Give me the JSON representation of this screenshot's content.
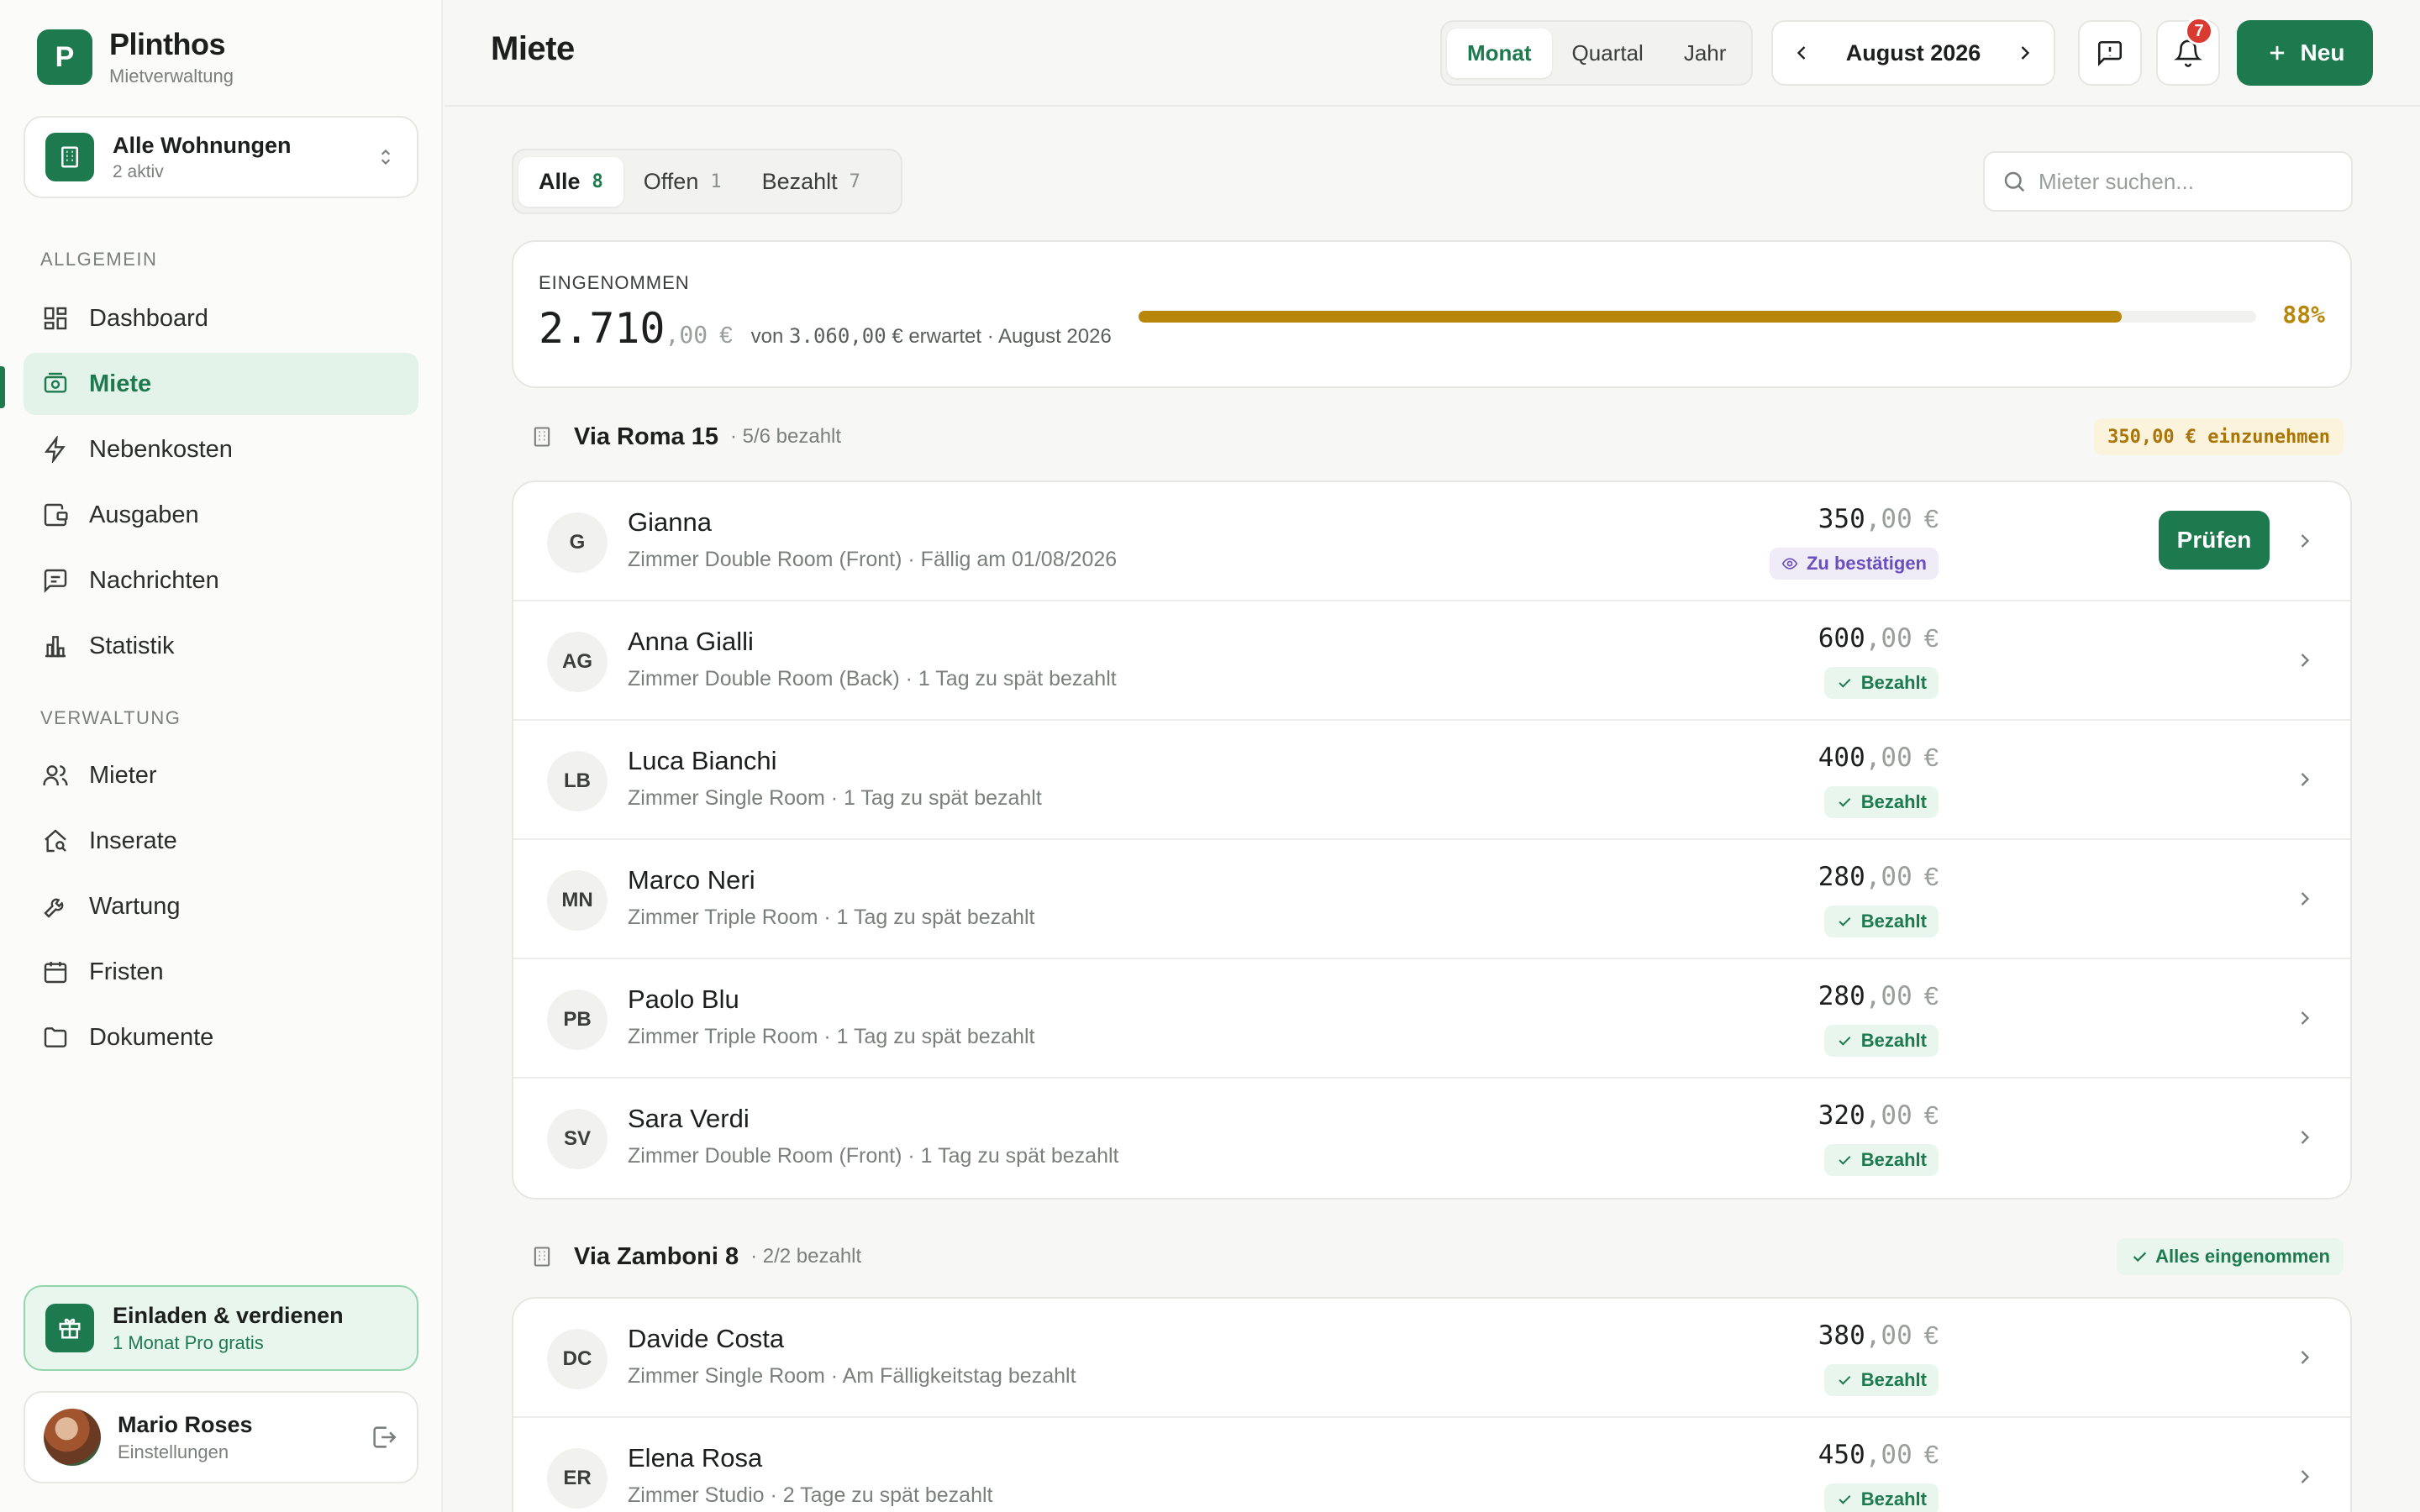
{
  "brand": {
    "logo_letter": "P",
    "name": "Plinthos",
    "subtitle": "Mietverwaltung"
  },
  "property_selector": {
    "title": "Alle Wohnungen",
    "subtitle": "2 aktiv"
  },
  "nav": {
    "section_general": "ALLGEMEIN",
    "section_admin": "VERWALTUNG",
    "items": [
      {
        "label": "Dashboard",
        "icon": "grid-icon"
      },
      {
        "label": "Miete",
        "icon": "rent-icon",
        "active": true
      },
      {
        "label": "Nebenkosten",
        "icon": "bolt-icon"
      },
      {
        "label": "Ausgaben",
        "icon": "wallet-icon"
      },
      {
        "label": "Nachrichten",
        "icon": "message-icon"
      },
      {
        "label": "Statistik",
        "icon": "bar-chart-icon"
      },
      {
        "label": "Mieter",
        "icon": "users-icon"
      },
      {
        "label": "Inserate",
        "icon": "house-search-icon"
      },
      {
        "label": "Wartung",
        "icon": "wrench-icon"
      },
      {
        "label": "Fristen",
        "icon": "calendar-icon"
      },
      {
        "label": "Dokumente",
        "icon": "folder-icon"
      }
    ]
  },
  "invite": {
    "title": "Einladen & verdienen",
    "subtitle": "1 Monat Pro gratis"
  },
  "user": {
    "name": "Mario Roses",
    "subtitle": "Einstellungen"
  },
  "header": {
    "title": "Miete",
    "periods": [
      "Monat",
      "Quartal",
      "Jahr"
    ],
    "active_period": "Monat",
    "date_label": "August 2026",
    "notification_count": "7",
    "new_label": "Neu"
  },
  "filters": [
    {
      "label": "Alle",
      "count": "8",
      "active": true
    },
    {
      "label": "Offen",
      "count": "1"
    },
    {
      "label": "Bezahlt",
      "count": "7"
    }
  ],
  "search": {
    "placeholder": "Mieter suchen..."
  },
  "summary": {
    "label": "EINGENOMMEN",
    "amount_int": "2.710",
    "amount_dec": ",00",
    "currency": "€",
    "von": "von",
    "expected_amount": "3.060,00",
    "expected_suffix": "€ erwartet · August 2026",
    "progress": 0.88,
    "percent_label": "88%"
  },
  "groups": [
    {
      "name": "Via Roma 15",
      "sub": "· 5/6 bezahlt",
      "tag": "350,00 € einzunehmen",
      "tag_type": "amber",
      "rows": [
        {
          "initials": "G",
          "name": "Gianna",
          "sub": "Zimmer Double Room (Front) · Fällig am 01/08/2026",
          "amount_int": "350",
          "amount_dec": ",00",
          "currency": "€",
          "status": "Zu bestätigen",
          "status_type": "confirm",
          "action": "Prüfen"
        },
        {
          "initials": "AG",
          "name": "Anna Gialli",
          "sub": "Zimmer Double Room (Back) · 1 Tag zu spät bezahlt",
          "amount_int": "600",
          "amount_dec": ",00",
          "currency": "€",
          "status": "Bezahlt",
          "status_type": "paid"
        },
        {
          "initials": "LB",
          "name": "Luca Bianchi",
          "sub": "Zimmer Single Room · 1 Tag zu spät bezahlt",
          "amount_int": "400",
          "amount_dec": ",00",
          "currency": "€",
          "status": "Bezahlt",
          "status_type": "paid"
        },
        {
          "initials": "MN",
          "name": "Marco Neri",
          "sub": "Zimmer Triple Room · 1 Tag zu spät bezahlt",
          "amount_int": "280",
          "amount_dec": ",00",
          "currency": "€",
          "status": "Bezahlt",
          "status_type": "paid"
        },
        {
          "initials": "PB",
          "name": "Paolo Blu",
          "sub": "Zimmer Triple Room · 1 Tag zu spät bezahlt",
          "amount_int": "280",
          "amount_dec": ",00",
          "currency": "€",
          "status": "Bezahlt",
          "status_type": "paid"
        },
        {
          "initials": "SV",
          "name": "Sara Verdi",
          "sub": "Zimmer Double Room (Front) · 1 Tag zu spät bezahlt",
          "amount_int": "320",
          "amount_dec": ",00",
          "currency": "€",
          "status": "Bezahlt",
          "status_type": "paid"
        }
      ]
    },
    {
      "name": "Via Zamboni 8",
      "sub": "· 2/2 bezahlt",
      "tag": "Alles eingenommen",
      "tag_type": "green",
      "rows": [
        {
          "initials": "DC",
          "name": "Davide Costa",
          "sub": "Zimmer Single Room · Am Fälligkeitstag bezahlt",
          "amount_int": "380",
          "amount_dec": ",00",
          "currency": "€",
          "status": "Bezahlt",
          "status_type": "paid"
        },
        {
          "initials": "ER",
          "name": "Elena Rosa",
          "sub": "Zimmer Studio · 2 Tage zu spät bezahlt",
          "amount_int": "450",
          "amount_dec": ",00",
          "currency": "€",
          "status": "Bezahlt",
          "status_type": "paid"
        }
      ]
    }
  ],
  "colors": {
    "accent": "#1d7a4f",
    "amber": "#b8860b",
    "confirm": "#6a4ec0",
    "danger": "#d93b30"
  }
}
